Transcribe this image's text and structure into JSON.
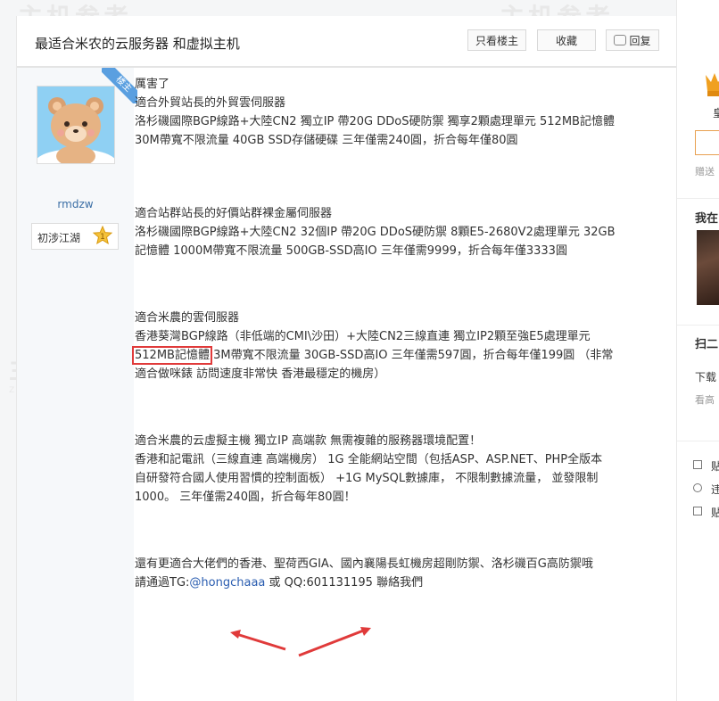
{
  "thread": {
    "title": "最适合米农的云服务器 和虚拟主机",
    "buttons": {
      "only_op": "只看楼主",
      "favorite": "收藏",
      "reply": "回复"
    }
  },
  "author": {
    "badge": "楼主",
    "username": "rmdzw",
    "rank": "初涉江湖",
    "rank_level": "1"
  },
  "post": {
    "sections": [
      {
        "lines": [
          "厲害了",
          "適合外貿站長的外貿雲伺服器",
          "洛杉磯國際BGP線路+大陸CN2 獨立IP 帶20G DDoS硬防禦 獨享2顆處理單元 512MB記憶體",
          "30M帶寬不限流量 40GB SSD存儲硬碟 三年僅需240圓，折合每年僅80圓"
        ]
      },
      {
        "lines": [
          "適合站群站長的好價站群裸金屬伺服器",
          "洛杉磯國際BGP線路+大陸CN2 32個IP 帶20G DDoS硬防禦 8顆E5-2680V2處理單元 32GB",
          "記憶體 1000M帶寬不限流量 500GB-SSD高IO 三年僅需9999，折合每年僅3333圓"
        ]
      },
      {
        "lines": [
          "適合米農的雲伺服器",
          "香港葵灣BGP線路（非低端的CMI\\沙田）+大陸CN2三線直連 獨立IP2顆至強E5處理單元"
        ],
        "highlight": "512MB記憶體",
        "after_highlight": " 3M帶寬不限流量 30GB-SSD高IO 三年僅需597圓，折合每年僅199圓 （非常",
        "last_line": "適合做咪錶 訪問速度非常快 香港最穩定的機房）"
      },
      {
        "lines": [
          "適合米農的云虛擬主機 獨立IP 高端款 無需複雜的服務器環境配置！",
          "香港和記電訊（三線直連 高端機房） 1G 全能網站空間（包括ASP、ASP.NET、PHP全版本",
          "自研發符合國人使用習慣的控制面板） +1G MySQL數據庫， 不限制數據流量， 並發限制",
          "1000。 三年僅需240圓，折合每年80圓！"
        ]
      },
      {
        "line1": "還有更適合大佬們的香港、聖荷西GIA、國內襄陽長虹機房超剛防禦、洛杉磯百G高防禦哦",
        "contact_prefix": "請通過TG:",
        "tg_handle": "@hongchaaa",
        "contact_middle": " 或 QQ:601131195 聯絡我們"
      }
    ]
  },
  "watermark": {
    "cn": "主机参考",
    "en": "ZHUJICANKAO.COM"
  },
  "sidebar": {
    "frag1": "皇",
    "frag2": "赠送",
    "heading1": "我在",
    "heading2": "扫二",
    "frag3": "下载",
    "frag4": "看高",
    "item1": "贴",
    "item2": "违",
    "item3": "贴"
  }
}
